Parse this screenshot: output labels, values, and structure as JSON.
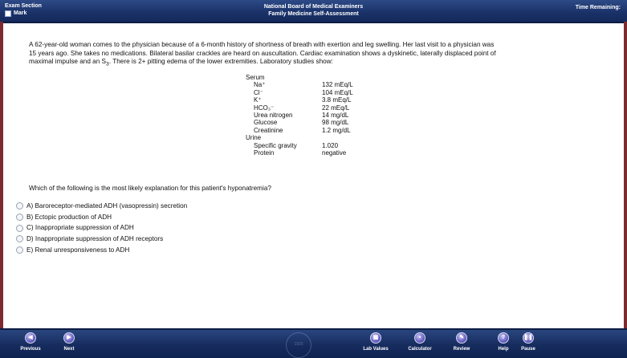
{
  "header": {
    "section_label": "Exam Section",
    "mark_label": "Mark",
    "org": "National Board of Medical Examiners",
    "assessment": "Family Medicine Self-Assessment",
    "time_label": "Time Remaining:"
  },
  "question": {
    "stem_line1": "A 62-year-old woman comes to the physician because of a 6-month history of shortness of breath with exertion and leg swelling. Her last visit to a physician was",
    "stem_line2": "15 years ago. She takes no medications. Bilateral basilar crackles are heard on auscultation. Cardiac examination shows a dyskinetic, laterally displaced point of",
    "stem_line3a": "maximal impulse and an S",
    "stem_line3_sub": "3",
    "stem_line3b": ". There is 2+ pitting edema of the lower extremities. Laboratory studies show:",
    "prompt": "Which of the following is the most likely explanation for this patient's hyponatremia?"
  },
  "labs": {
    "serum_heading": "Serum",
    "serum": [
      {
        "name": "Na⁺",
        "value": "132 mEq/L"
      },
      {
        "name": "Cl⁻",
        "value": "104 mEq/L"
      },
      {
        "name": "K⁺",
        "value": "3.8 mEq/L"
      },
      {
        "name": "HCO₃⁻",
        "value": "22 mEq/L"
      },
      {
        "name": "Urea nitrogen",
        "value": "14 mg/dL"
      },
      {
        "name": "Glucose",
        "value": "98 mg/dL"
      },
      {
        "name": "Creatinine",
        "value": "1.2 mg/dL"
      }
    ],
    "urine_heading": "Urine",
    "urine": [
      {
        "name": "Specific gravity",
        "value": "1.020"
      },
      {
        "name": "Protein",
        "value": "negative"
      }
    ]
  },
  "options": [
    {
      "letter": "A)",
      "text": "Baroreceptor-mediated ADH (vasopressin) secretion"
    },
    {
      "letter": "B)",
      "text": "Ectopic production of ADH"
    },
    {
      "letter": "C)",
      "text": "Inappropriate suppression of ADH"
    },
    {
      "letter": "D)",
      "text": "Inappropriate suppression of ADH receptors"
    },
    {
      "letter": "E)",
      "text": "Renal unresponsiveness to ADH"
    }
  ],
  "footer": {
    "previous": "Previous",
    "next": "Next",
    "lab_values": "Lab Values",
    "calculator": "Calculator",
    "review": "Review",
    "help": "Help",
    "pause": "Pause",
    "seal_text": "1915"
  },
  "colors": {
    "header_bg": "#1a3168",
    "footer_bg": "#162c5e",
    "side_edge": "#7d2a2e",
    "button_icon": "#6e67c7"
  }
}
